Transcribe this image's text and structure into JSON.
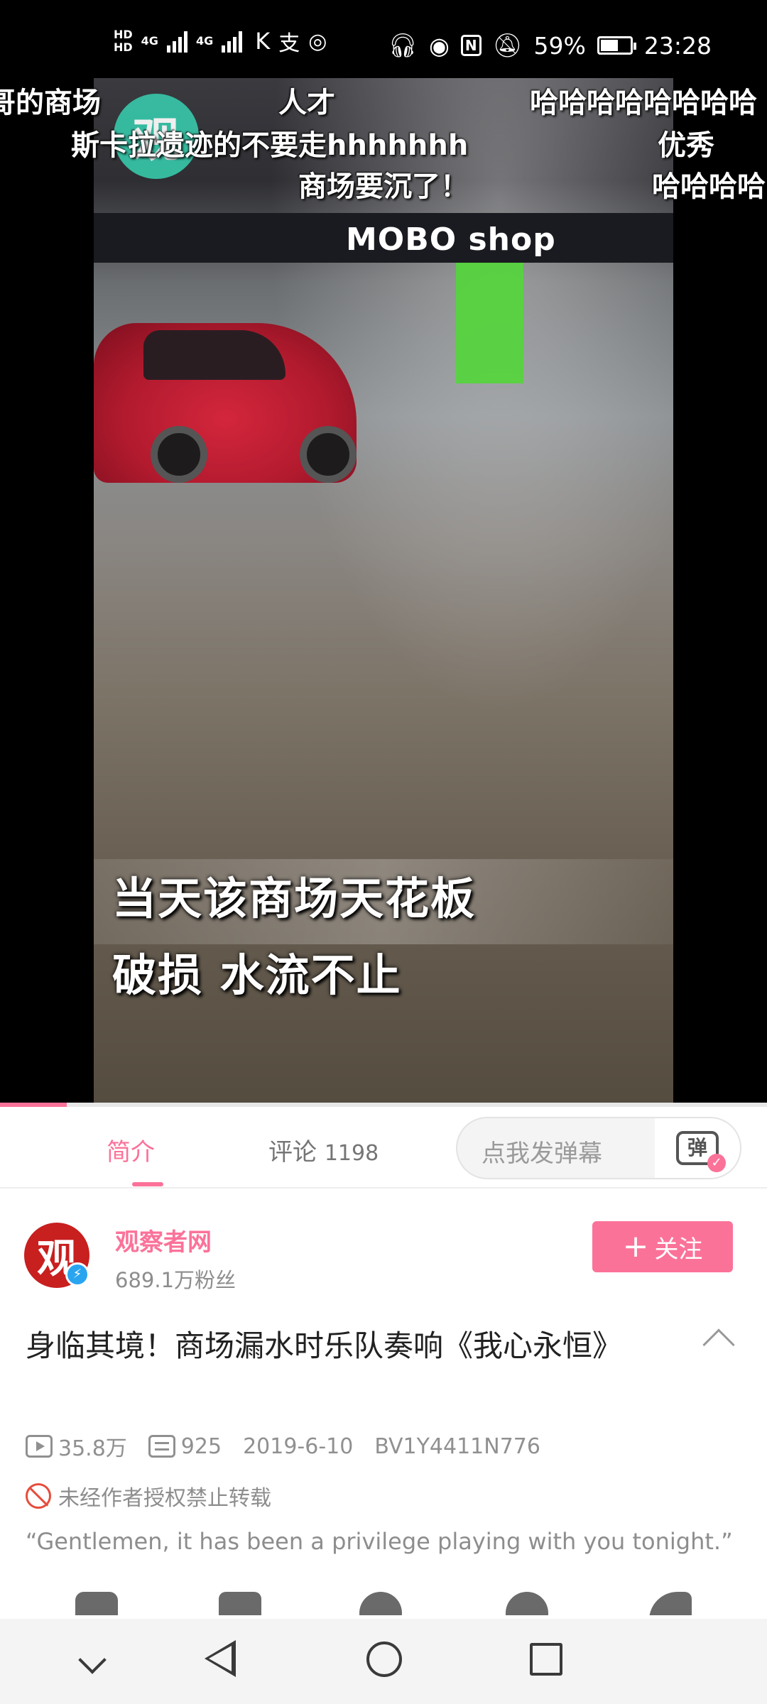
{
  "status_bar": {
    "hd1": "HD",
    "hd2": "HD",
    "net1": "4G",
    "net2": "4G",
    "battery_percent": "59%",
    "battery_level": 0.59,
    "time": "23:28"
  },
  "video": {
    "channel_watermark": "观",
    "store_sign": "MOBO shop",
    "subtitle_line1": "当天该商场天花板",
    "subtitle_line2": "破损 水流不止",
    "progress": 0.087,
    "danmaku": [
      "哥的商场",
      "人才",
      "哈哈哈哈哈哈哈哈",
      "斯卡拉遗迹的不要走hhhhhhh",
      "优秀",
      "商场要沉了！",
      "哈哈哈哈"
    ]
  },
  "tabs": {
    "intro_label": "简介",
    "comments_label": "评论",
    "comments_count": "1198",
    "danmu_placeholder": "点我发弹幕",
    "danmu_button_glyph": "弹"
  },
  "author": {
    "avatar_glyph": "观",
    "name": "观察者网",
    "followers": "689.1万粉丝",
    "follow_label": "关注"
  },
  "video_info": {
    "title": "身临其境！商场漏水时乐队奏响《我心永恒》",
    "views": "35.8万",
    "danmaku_count": "925",
    "date": "2019-6-10",
    "bvid": "BV1Y4411N776",
    "copyright_notice": "未经作者授权禁止转载",
    "description": "“Gentlemen, it has been a privilege playing with you tonight.”"
  },
  "colors": {
    "accent": "#fb7299",
    "verified": "#29a5f0"
  },
  "icons": {
    "collapse": "chevron-up-icon",
    "nav": [
      "chevron-down-icon",
      "back-icon",
      "home-icon",
      "recent-apps-icon"
    ]
  }
}
